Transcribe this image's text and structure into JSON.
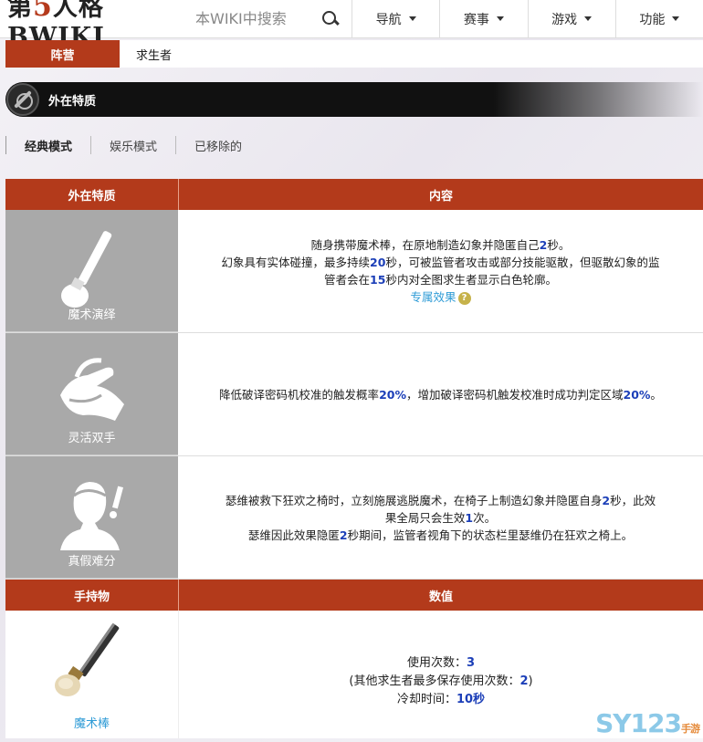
{
  "header": {
    "logo_prefix": "第",
    "logo_five": "5",
    "logo_suffix": "人格",
    "logo_wiki": "BWIKI",
    "search_placeholder": "本WIKI中搜索",
    "nav": [
      "导航",
      "赛事",
      "游戏",
      "功能"
    ]
  },
  "camp": {
    "label": "阵营",
    "value": "求生者"
  },
  "section": {
    "title": "外在特质"
  },
  "tabs": [
    "经典模式",
    "娱乐模式",
    "已移除的"
  ],
  "traits_table": {
    "col1": "外在特质",
    "col2": "内容",
    "rows": [
      {
        "name": "魔术演绎",
        "icon": "magic-wand-icon",
        "lines": [
          [
            "随身携带魔术棒，在原地制造幻象并隐匿自己",
            "2",
            "秒。"
          ],
          [
            "幻象具有实体碰撞，最多持续",
            "20",
            "秒，可被监管者攻击或部分技能驱散，但驱散幻象的监"
          ],
          [
            "管者会在",
            "15",
            "秒内对全图求生者显示白色轮廓。"
          ]
        ],
        "link": "专属效果",
        "help": "?"
      },
      {
        "name": "灵活双手",
        "icon": "dexterous-hands-icon",
        "lines": [
          [
            "降低破译密码机校准的触发概率",
            "20%",
            "，增加破译密码机触发校准时成功判定区域",
            "20%",
            "。"
          ]
        ]
      },
      {
        "name": "真假难分",
        "icon": "person-exclaim-icon",
        "lines": [
          [
            "瑟维被救下狂欢之椅时，立刻施展逃脱魔术，在椅子上制造幻象并隐匿自身",
            "2",
            "秒，此效"
          ],
          [
            "果全局只会生效",
            "1",
            "次。"
          ],
          [
            "瑟维因此效果隐匿",
            "2",
            "秒期间，监管者视角下的状态栏里瑟维仍在狂欢之椅上。"
          ]
        ]
      }
    ]
  },
  "item_table": {
    "col1": "手持物",
    "col2": "数值",
    "item_name": "魔术棒",
    "uses_label": "使用次数：",
    "uses_value": "3",
    "store_prefix": "(其他求生者最多保存使用次数：",
    "store_value": "2",
    "store_suffix": ")",
    "cooldown_label": "冷却时间：",
    "cooldown_value": "10秒"
  },
  "watermark": {
    "main": "SY123",
    "sub": "手游"
  }
}
